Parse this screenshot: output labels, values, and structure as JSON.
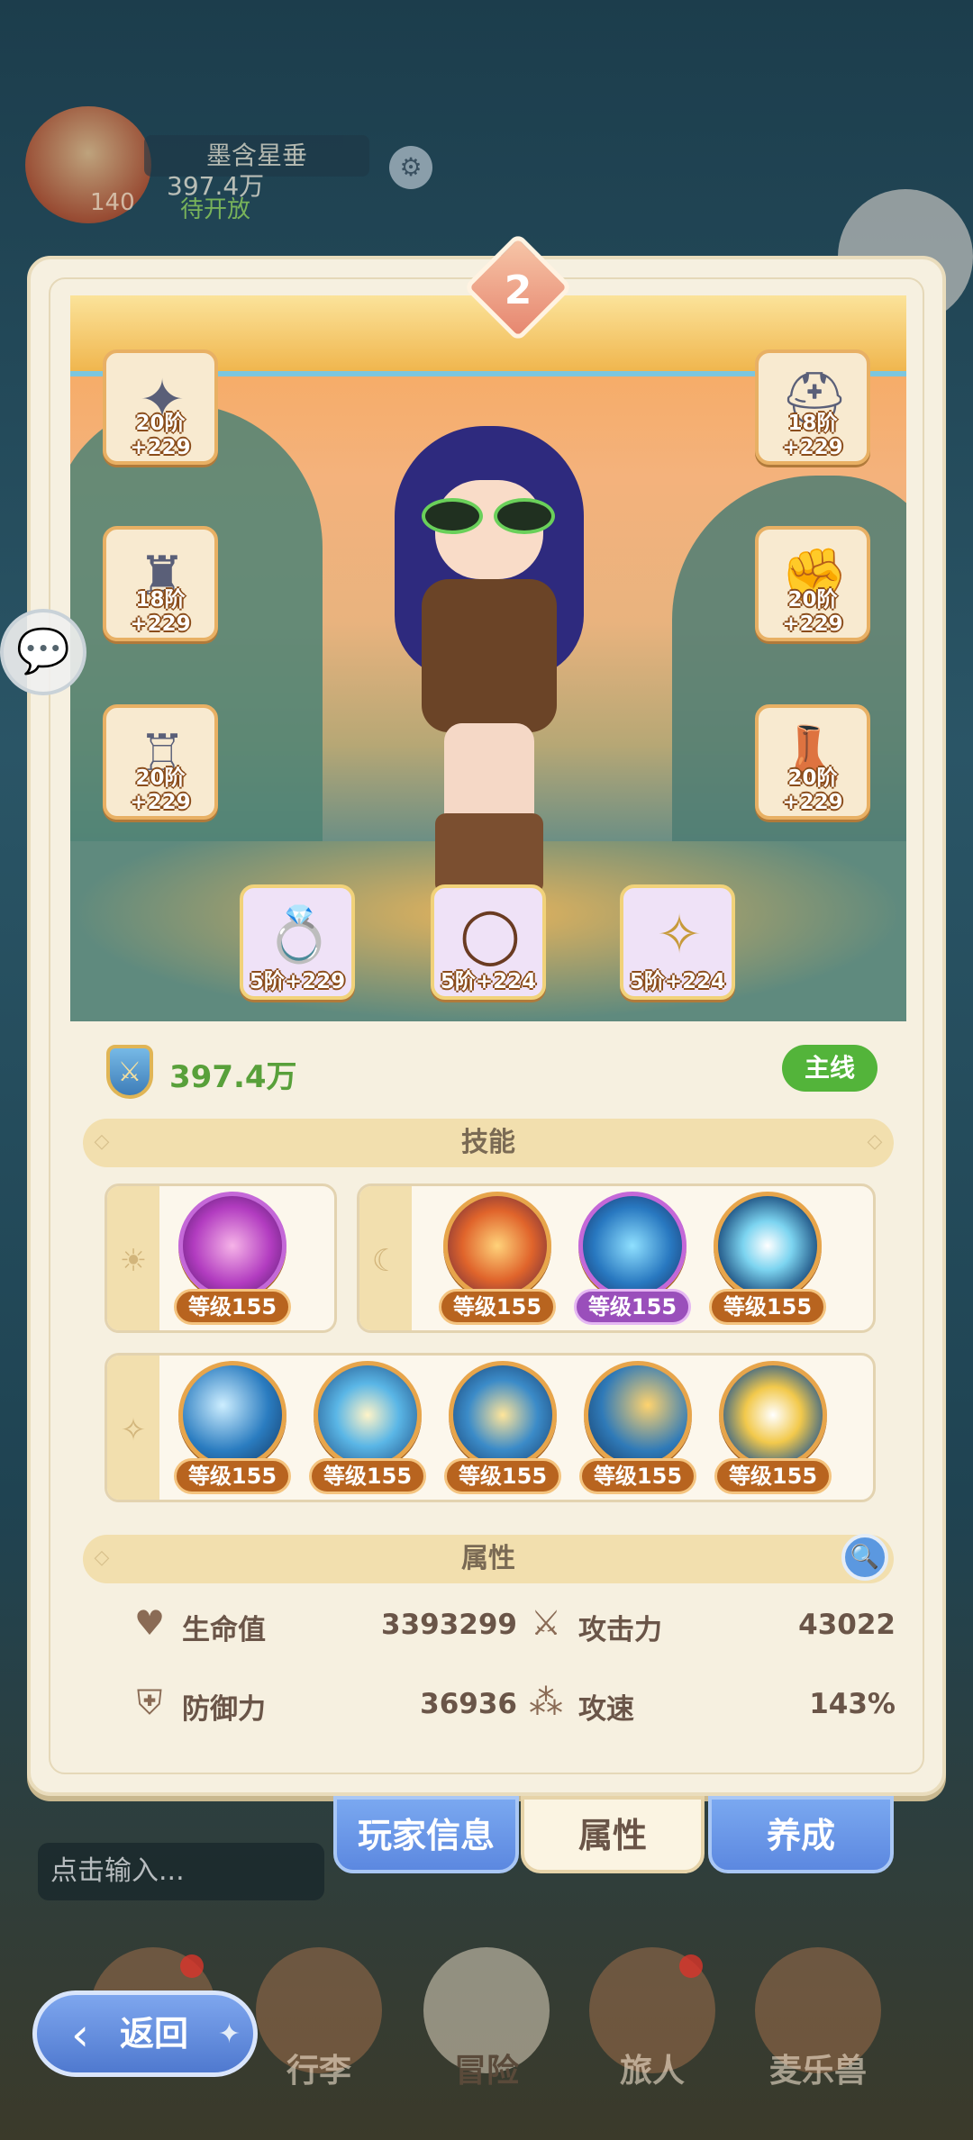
{
  "hud": {
    "player_name": "墨含星垂",
    "power": "397.4万",
    "level": "140",
    "status": "待开放"
  },
  "panel": {
    "rank": "2",
    "equipment": [
      {
        "slot": "weapon",
        "label": "20阶+229",
        "icon": "halberd-icon"
      },
      {
        "slot": "helmet",
        "label": "18阶+229",
        "icon": "helmet-icon"
      },
      {
        "slot": "armor",
        "label": "18阶+229",
        "icon": "armor-icon"
      },
      {
        "slot": "gloves",
        "label": "20阶+229",
        "icon": "gauntlet-icon"
      },
      {
        "slot": "pants",
        "label": "20阶+229",
        "icon": "leg-armor-icon"
      },
      {
        "slot": "boots",
        "label": "20阶+229",
        "icon": "boots-icon"
      },
      {
        "slot": "ring",
        "label": "5阶+229",
        "icon": "ring-icon"
      },
      {
        "slot": "necklace",
        "label": "5阶+224",
        "icon": "necklace-icon"
      },
      {
        "slot": "amulet",
        "label": "5阶+224",
        "icon": "amulet-icon"
      }
    ],
    "power": "397.4万",
    "main_badge": "主线",
    "skills_title": "技能",
    "skill_groups": [
      {
        "tab_icon": "sun-icon",
        "skills": [
          {
            "level": "等级155",
            "color": "purple-pink"
          }
        ]
      },
      {
        "tab_icon": "moon-icon",
        "skills": [
          {
            "level": "等级155",
            "color": "orange-lightning"
          },
          {
            "level": "等级155",
            "color": "blue-flame",
            "highlight": "purple"
          },
          {
            "level": "等级155",
            "color": "light-blue-orb"
          }
        ]
      },
      {
        "tab_icon": "star-icon",
        "skills": [
          {
            "level": "等级155",
            "color": "blue-wave"
          },
          {
            "level": "等级155",
            "color": "blue-swirl"
          },
          {
            "level": "等级155",
            "color": "blue-cross"
          },
          {
            "level": "等级155",
            "color": "blue-comet"
          },
          {
            "level": "等级155",
            "color": "gold-burst"
          }
        ]
      }
    ],
    "attributes_title": "属性",
    "attributes": [
      {
        "name": "生命值",
        "value": "3393299",
        "icon": "heart-icon"
      },
      {
        "name": "攻击力",
        "value": "43022",
        "icon": "crossed-swords-icon"
      },
      {
        "name": "防御力",
        "value": "36936",
        "icon": "shield-icon"
      },
      {
        "name": "攻速",
        "value": "143%",
        "icon": "speed-icon"
      }
    ]
  },
  "tabs": [
    {
      "label": "玩家信息",
      "active": false
    },
    {
      "label": "属性",
      "active": true
    },
    {
      "label": "养成",
      "active": false
    }
  ],
  "chat": {
    "placeholder": "点击输入..."
  },
  "bottom_nav": [
    {
      "label": "行李",
      "dot": false
    },
    {
      "label": "冒险",
      "dot": false
    },
    {
      "label": "旅人",
      "dot": true
    },
    {
      "label": "麦乐兽",
      "dot": false
    }
  ],
  "back_button": {
    "label": "返回"
  }
}
